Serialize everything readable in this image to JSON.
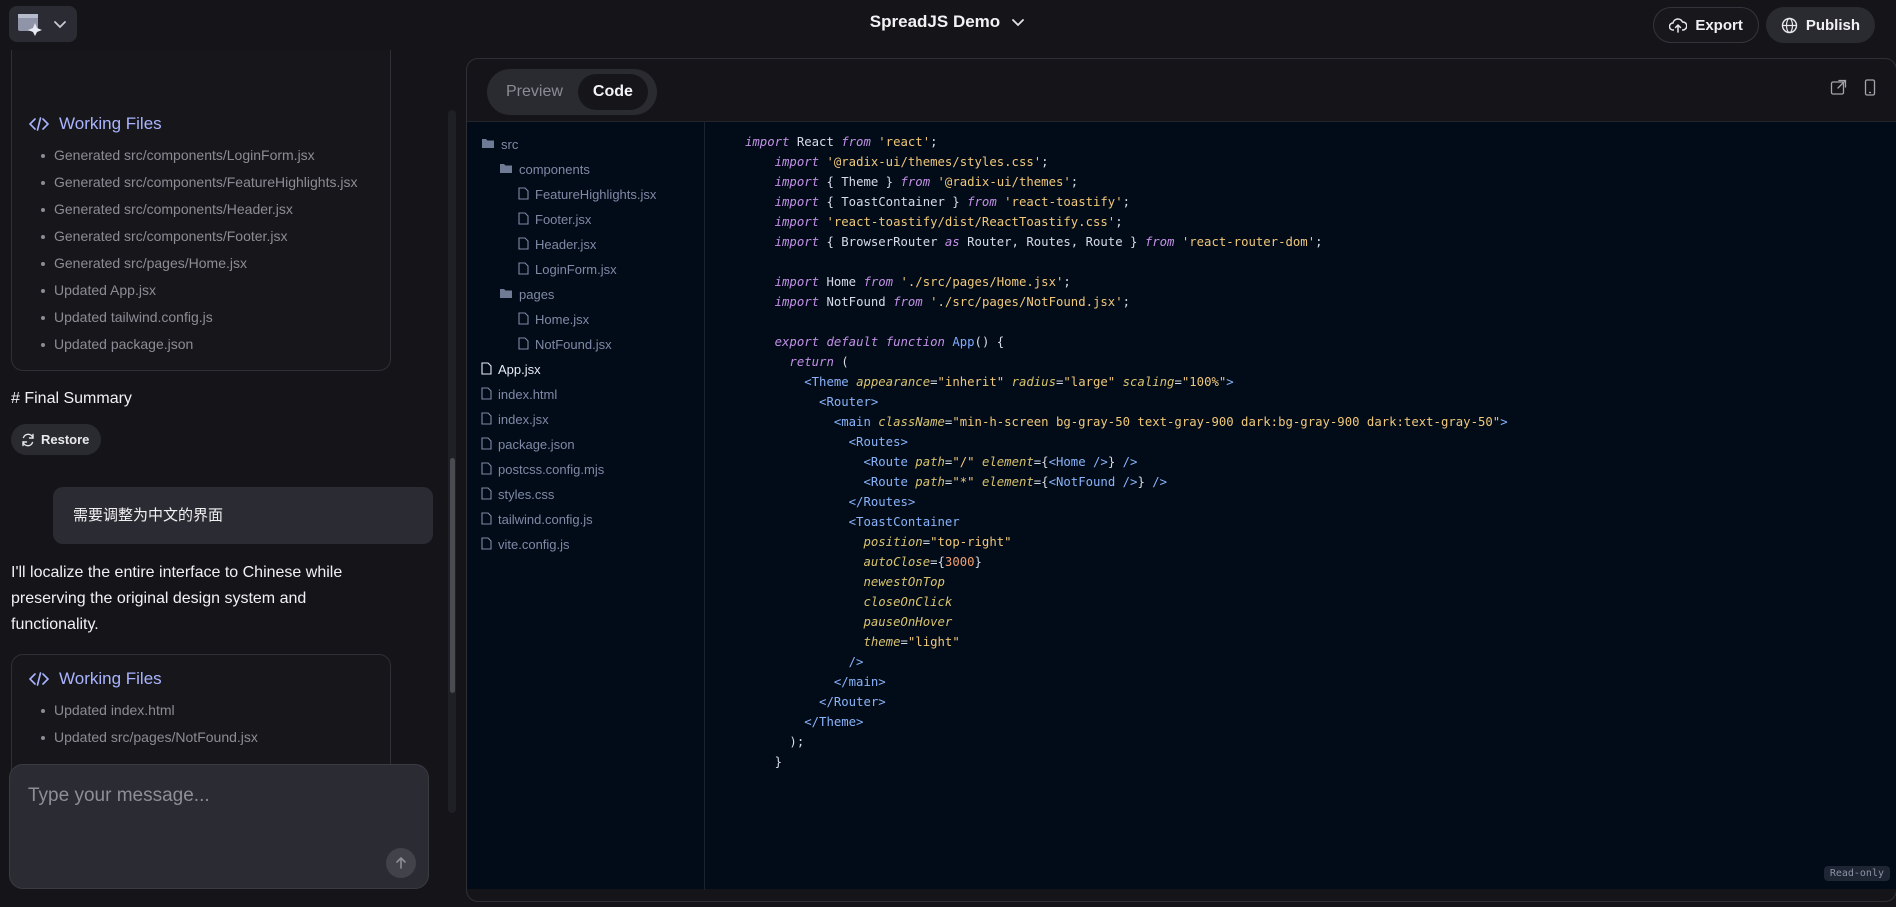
{
  "header": {
    "project_title": "SpreadJS Demo",
    "export_label": "Export",
    "publish_label": "Publish"
  },
  "chat": {
    "card1": {
      "title": "Working Files",
      "items": [
        "Generated src/components/LoginForm.jsx",
        "Generated src/components/FeatureHighlights.jsx",
        "Generated src/components/Header.jsx",
        "Generated src/components/Footer.jsx",
        "Generated src/pages/Home.jsx",
        "Updated App.jsx",
        "Updated tailwind.config.js",
        "Updated package.json"
      ]
    },
    "final_summary": "# Final Summary",
    "restore_label": "Restore",
    "user_message": "需要调整为中文的界面",
    "assistant_message": "I'll localize the entire interface to Chinese while preserving the original design system and functionality.",
    "card2": {
      "title": "Working Files",
      "items": [
        "Updated index.html",
        "Updated src/pages/NotFound.jsx"
      ]
    },
    "composer_placeholder": "Type your message..."
  },
  "editor": {
    "tabs": {
      "preview": "Preview",
      "code": "Code"
    },
    "read_only": "Read-only",
    "tree": [
      {
        "name": "src",
        "type": "folder",
        "depth": 1
      },
      {
        "name": "components",
        "type": "folder",
        "depth": 2
      },
      {
        "name": "FeatureHighlights.jsx",
        "type": "file",
        "depth": 3
      },
      {
        "name": "Footer.jsx",
        "type": "file",
        "depth": 3
      },
      {
        "name": "Header.jsx",
        "type": "file",
        "depth": 3
      },
      {
        "name": "LoginForm.jsx",
        "type": "file",
        "depth": 3
      },
      {
        "name": "pages",
        "type": "folder",
        "depth": 2
      },
      {
        "name": "Home.jsx",
        "type": "file",
        "depth": 3
      },
      {
        "name": "NotFound.jsx",
        "type": "file",
        "depth": 3
      },
      {
        "name": "App.jsx",
        "type": "file",
        "depth": 1,
        "active": true
      },
      {
        "name": "index.html",
        "type": "file",
        "depth": 1
      },
      {
        "name": "index.jsx",
        "type": "file",
        "depth": 1
      },
      {
        "name": "package.json",
        "type": "file",
        "depth": 1
      },
      {
        "name": "postcss.config.mjs",
        "type": "file",
        "depth": 1
      },
      {
        "name": "styles.css",
        "type": "file",
        "depth": 1
      },
      {
        "name": "tailwind.config.js",
        "type": "file",
        "depth": 1
      },
      {
        "name": "vite.config.js",
        "type": "file",
        "depth": 1
      }
    ],
    "code_lines": [
      [
        [
          "kw",
          "import"
        ],
        [
          "p",
          " React "
        ],
        [
          "kw",
          "from"
        ],
        [
          "p",
          " "
        ],
        [
          "str",
          "'react'"
        ],
        [
          "p",
          ";"
        ]
      ],
      [
        [
          "p",
          "    "
        ],
        [
          "kw",
          "import"
        ],
        [
          "p",
          " "
        ],
        [
          "str",
          "'@radix-ui/themes/styles.css'"
        ],
        [
          "p",
          ";"
        ]
      ],
      [
        [
          "p",
          "    "
        ],
        [
          "kw",
          "import"
        ],
        [
          "p",
          " { Theme } "
        ],
        [
          "kw",
          "from"
        ],
        [
          "p",
          " "
        ],
        [
          "str",
          "'@radix-ui/themes'"
        ],
        [
          "p",
          ";"
        ]
      ],
      [
        [
          "p",
          "    "
        ],
        [
          "kw",
          "import"
        ],
        [
          "p",
          " { ToastContainer } "
        ],
        [
          "kw",
          "from"
        ],
        [
          "p",
          " "
        ],
        [
          "str",
          "'react-toastify'"
        ],
        [
          "p",
          ";"
        ]
      ],
      [
        [
          "p",
          "    "
        ],
        [
          "kw",
          "import"
        ],
        [
          "p",
          " "
        ],
        [
          "str",
          "'react-toastify/dist/ReactToastify.css'"
        ],
        [
          "p",
          ";"
        ]
      ],
      [
        [
          "p",
          "    "
        ],
        [
          "kw",
          "import"
        ],
        [
          "p",
          " { BrowserRouter "
        ],
        [
          "kw",
          "as"
        ],
        [
          "p",
          " Router, Routes, Route } "
        ],
        [
          "kw",
          "from"
        ],
        [
          "p",
          " "
        ],
        [
          "str",
          "'react-router-dom'"
        ],
        [
          "p",
          ";"
        ]
      ],
      [
        [
          "p",
          ""
        ]
      ],
      [
        [
          "p",
          "    "
        ],
        [
          "kw",
          "import"
        ],
        [
          "p",
          " Home "
        ],
        [
          "kw",
          "from"
        ],
        [
          "p",
          " "
        ],
        [
          "str",
          "'./src/pages/Home.jsx'"
        ],
        [
          "p",
          ";"
        ]
      ],
      [
        [
          "p",
          "    "
        ],
        [
          "kw",
          "import"
        ],
        [
          "p",
          " NotFound "
        ],
        [
          "kw",
          "from"
        ],
        [
          "p",
          " "
        ],
        [
          "str",
          "'./src/pages/NotFound.jsx'"
        ],
        [
          "p",
          ";"
        ]
      ],
      [
        [
          "p",
          ""
        ]
      ],
      [
        [
          "p",
          "    "
        ],
        [
          "kw",
          "export"
        ],
        [
          "p",
          " "
        ],
        [
          "kw",
          "default"
        ],
        [
          "p",
          " "
        ],
        [
          "kw",
          "function"
        ],
        [
          "p",
          " "
        ],
        [
          "fn",
          "App"
        ],
        [
          "p",
          "() {"
        ]
      ],
      [
        [
          "p",
          "      "
        ],
        [
          "kw",
          "return"
        ],
        [
          "p",
          " ("
        ]
      ],
      [
        [
          "p",
          "        "
        ],
        [
          "tag",
          "<Theme"
        ],
        [
          "p",
          " "
        ],
        [
          "attr",
          "appearance"
        ],
        [
          "p",
          "="
        ],
        [
          "str",
          "\"inherit\""
        ],
        [
          "p",
          " "
        ],
        [
          "attr",
          "radius"
        ],
        [
          "p",
          "="
        ],
        [
          "str",
          "\"large\""
        ],
        [
          "p",
          " "
        ],
        [
          "attr",
          "scaling"
        ],
        [
          "p",
          "="
        ],
        [
          "str",
          "\"100%\""
        ],
        [
          "tag",
          ">"
        ]
      ],
      [
        [
          "p",
          "          "
        ],
        [
          "tag",
          "<Router>"
        ]
      ],
      [
        [
          "p",
          "            "
        ],
        [
          "tag",
          "<main"
        ],
        [
          "p",
          " "
        ],
        [
          "attr",
          "className"
        ],
        [
          "p",
          "="
        ],
        [
          "str",
          "\"min-h-screen bg-gray-50 text-gray-900 dark:bg-gray-900 dark:text-gray-50\""
        ],
        [
          "tag",
          ">"
        ]
      ],
      [
        [
          "p",
          "              "
        ],
        [
          "tag",
          "<Routes>"
        ]
      ],
      [
        [
          "p",
          "                "
        ],
        [
          "tag",
          "<Route"
        ],
        [
          "p",
          " "
        ],
        [
          "attr",
          "path"
        ],
        [
          "p",
          "="
        ],
        [
          "str",
          "\"/\""
        ],
        [
          "p",
          " "
        ],
        [
          "attr",
          "element"
        ],
        [
          "p",
          "={"
        ],
        [
          "tag",
          "<Home"
        ],
        [
          "p",
          " "
        ],
        [
          "tag",
          "/>"
        ],
        [
          "p",
          "} "
        ],
        [
          "tag",
          "/>"
        ]
      ],
      [
        [
          "p",
          "                "
        ],
        [
          "tag",
          "<Route"
        ],
        [
          "p",
          " "
        ],
        [
          "attr",
          "path"
        ],
        [
          "p",
          "="
        ],
        [
          "str",
          "\"*\""
        ],
        [
          "p",
          " "
        ],
        [
          "attr",
          "element"
        ],
        [
          "p",
          "={"
        ],
        [
          "tag",
          "<NotFound"
        ],
        [
          "p",
          " "
        ],
        [
          "tag",
          "/>"
        ],
        [
          "p",
          "} "
        ],
        [
          "tag",
          "/>"
        ]
      ],
      [
        [
          "p",
          "              "
        ],
        [
          "tag",
          "</Routes>"
        ]
      ],
      [
        [
          "p",
          "              "
        ],
        [
          "tag",
          "<ToastContainer"
        ]
      ],
      [
        [
          "p",
          "                "
        ],
        [
          "attr",
          "position"
        ],
        [
          "p",
          "="
        ],
        [
          "str",
          "\"top-right\""
        ]
      ],
      [
        [
          "p",
          "                "
        ],
        [
          "attr",
          "autoClose"
        ],
        [
          "p",
          "={"
        ],
        [
          "num",
          "3000"
        ],
        [
          "p",
          "}"
        ]
      ],
      [
        [
          "p",
          "                "
        ],
        [
          "attr",
          "newestOnTop"
        ]
      ],
      [
        [
          "p",
          "                "
        ],
        [
          "attr",
          "closeOnClick"
        ]
      ],
      [
        [
          "p",
          "                "
        ],
        [
          "attr",
          "pauseOnHover"
        ]
      ],
      [
        [
          "p",
          "                "
        ],
        [
          "attr",
          "theme"
        ],
        [
          "p",
          "="
        ],
        [
          "str",
          "\"light\""
        ]
      ],
      [
        [
          "p",
          "              "
        ],
        [
          "tag",
          "/>"
        ]
      ],
      [
        [
          "p",
          "            "
        ],
        [
          "tag",
          "</main>"
        ]
      ],
      [
        [
          "p",
          "          "
        ],
        [
          "tag",
          "</Router>"
        ]
      ],
      [
        [
          "p",
          "        "
        ],
        [
          "tag",
          "</Theme>"
        ]
      ],
      [
        [
          "p",
          "      );"
        ]
      ],
      [
        [
          "p",
          "    }"
        ]
      ]
    ]
  },
  "colors": {
    "accent": "#a9b4ff",
    "code_bg": "#020b18",
    "panel_bg": "#151519"
  },
  "icons": {
    "logo": "app-logo-icon",
    "export": "cloud-upload-icon",
    "publish": "globe-icon",
    "working_files": "code-icon",
    "restore": "refresh-icon",
    "send": "arrow-up-icon"
  }
}
